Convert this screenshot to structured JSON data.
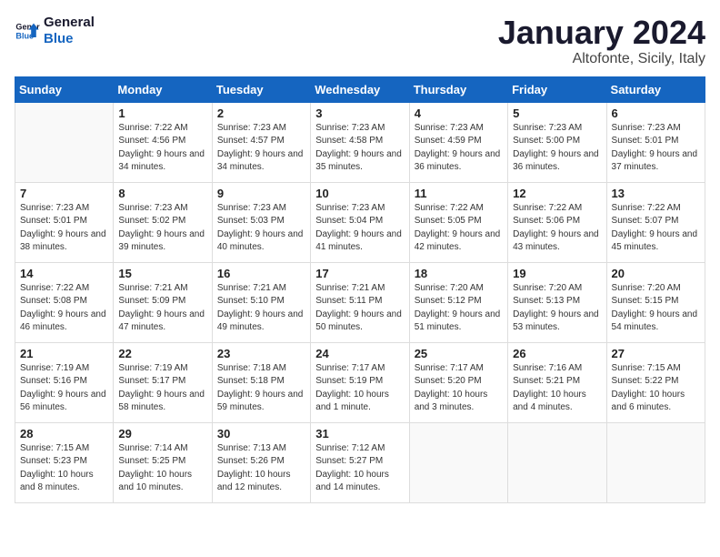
{
  "logo": {
    "line1": "General",
    "line2": "Blue"
  },
  "title": "January 2024",
  "subtitle": "Altofonte, Sicily, Italy",
  "weekdays": [
    "Sunday",
    "Monday",
    "Tuesday",
    "Wednesday",
    "Thursday",
    "Friday",
    "Saturday"
  ],
  "weeks": [
    [
      {
        "day": "",
        "sunrise": "",
        "sunset": "",
        "daylight": ""
      },
      {
        "day": "1",
        "sunrise": "7:22 AM",
        "sunset": "4:56 PM",
        "daylight": "9 hours and 34 minutes."
      },
      {
        "day": "2",
        "sunrise": "7:23 AM",
        "sunset": "4:57 PM",
        "daylight": "9 hours and 34 minutes."
      },
      {
        "day": "3",
        "sunrise": "7:23 AM",
        "sunset": "4:58 PM",
        "daylight": "9 hours and 35 minutes."
      },
      {
        "day": "4",
        "sunrise": "7:23 AM",
        "sunset": "4:59 PM",
        "daylight": "9 hours and 36 minutes."
      },
      {
        "day": "5",
        "sunrise": "7:23 AM",
        "sunset": "5:00 PM",
        "daylight": "9 hours and 36 minutes."
      },
      {
        "day": "6",
        "sunrise": "7:23 AM",
        "sunset": "5:01 PM",
        "daylight": "9 hours and 37 minutes."
      }
    ],
    [
      {
        "day": "7",
        "sunrise": "7:23 AM",
        "sunset": "5:01 PM",
        "daylight": "9 hours and 38 minutes."
      },
      {
        "day": "8",
        "sunrise": "7:23 AM",
        "sunset": "5:02 PM",
        "daylight": "9 hours and 39 minutes."
      },
      {
        "day": "9",
        "sunrise": "7:23 AM",
        "sunset": "5:03 PM",
        "daylight": "9 hours and 40 minutes."
      },
      {
        "day": "10",
        "sunrise": "7:23 AM",
        "sunset": "5:04 PM",
        "daylight": "9 hours and 41 minutes."
      },
      {
        "day": "11",
        "sunrise": "7:22 AM",
        "sunset": "5:05 PM",
        "daylight": "9 hours and 42 minutes."
      },
      {
        "day": "12",
        "sunrise": "7:22 AM",
        "sunset": "5:06 PM",
        "daylight": "9 hours and 43 minutes."
      },
      {
        "day": "13",
        "sunrise": "7:22 AM",
        "sunset": "5:07 PM",
        "daylight": "9 hours and 45 minutes."
      }
    ],
    [
      {
        "day": "14",
        "sunrise": "7:22 AM",
        "sunset": "5:08 PM",
        "daylight": "9 hours and 46 minutes."
      },
      {
        "day": "15",
        "sunrise": "7:21 AM",
        "sunset": "5:09 PM",
        "daylight": "9 hours and 47 minutes."
      },
      {
        "day": "16",
        "sunrise": "7:21 AM",
        "sunset": "5:10 PM",
        "daylight": "9 hours and 49 minutes."
      },
      {
        "day": "17",
        "sunrise": "7:21 AM",
        "sunset": "5:11 PM",
        "daylight": "9 hours and 50 minutes."
      },
      {
        "day": "18",
        "sunrise": "7:20 AM",
        "sunset": "5:12 PM",
        "daylight": "9 hours and 51 minutes."
      },
      {
        "day": "19",
        "sunrise": "7:20 AM",
        "sunset": "5:13 PM",
        "daylight": "9 hours and 53 minutes."
      },
      {
        "day": "20",
        "sunrise": "7:20 AM",
        "sunset": "5:15 PM",
        "daylight": "9 hours and 54 minutes."
      }
    ],
    [
      {
        "day": "21",
        "sunrise": "7:19 AM",
        "sunset": "5:16 PM",
        "daylight": "9 hours and 56 minutes."
      },
      {
        "day": "22",
        "sunrise": "7:19 AM",
        "sunset": "5:17 PM",
        "daylight": "9 hours and 58 minutes."
      },
      {
        "day": "23",
        "sunrise": "7:18 AM",
        "sunset": "5:18 PM",
        "daylight": "9 hours and 59 minutes."
      },
      {
        "day": "24",
        "sunrise": "7:17 AM",
        "sunset": "5:19 PM",
        "daylight": "10 hours and 1 minute."
      },
      {
        "day": "25",
        "sunrise": "7:17 AM",
        "sunset": "5:20 PM",
        "daylight": "10 hours and 3 minutes."
      },
      {
        "day": "26",
        "sunrise": "7:16 AM",
        "sunset": "5:21 PM",
        "daylight": "10 hours and 4 minutes."
      },
      {
        "day": "27",
        "sunrise": "7:15 AM",
        "sunset": "5:22 PM",
        "daylight": "10 hours and 6 minutes."
      }
    ],
    [
      {
        "day": "28",
        "sunrise": "7:15 AM",
        "sunset": "5:23 PM",
        "daylight": "10 hours and 8 minutes."
      },
      {
        "day": "29",
        "sunrise": "7:14 AM",
        "sunset": "5:25 PM",
        "daylight": "10 hours and 10 minutes."
      },
      {
        "day": "30",
        "sunrise": "7:13 AM",
        "sunset": "5:26 PM",
        "daylight": "10 hours and 12 minutes."
      },
      {
        "day": "31",
        "sunrise": "7:12 AM",
        "sunset": "5:27 PM",
        "daylight": "10 hours and 14 minutes."
      },
      {
        "day": "",
        "sunrise": "",
        "sunset": "",
        "daylight": ""
      },
      {
        "day": "",
        "sunrise": "",
        "sunset": "",
        "daylight": ""
      },
      {
        "day": "",
        "sunrise": "",
        "sunset": "",
        "daylight": ""
      }
    ]
  ]
}
